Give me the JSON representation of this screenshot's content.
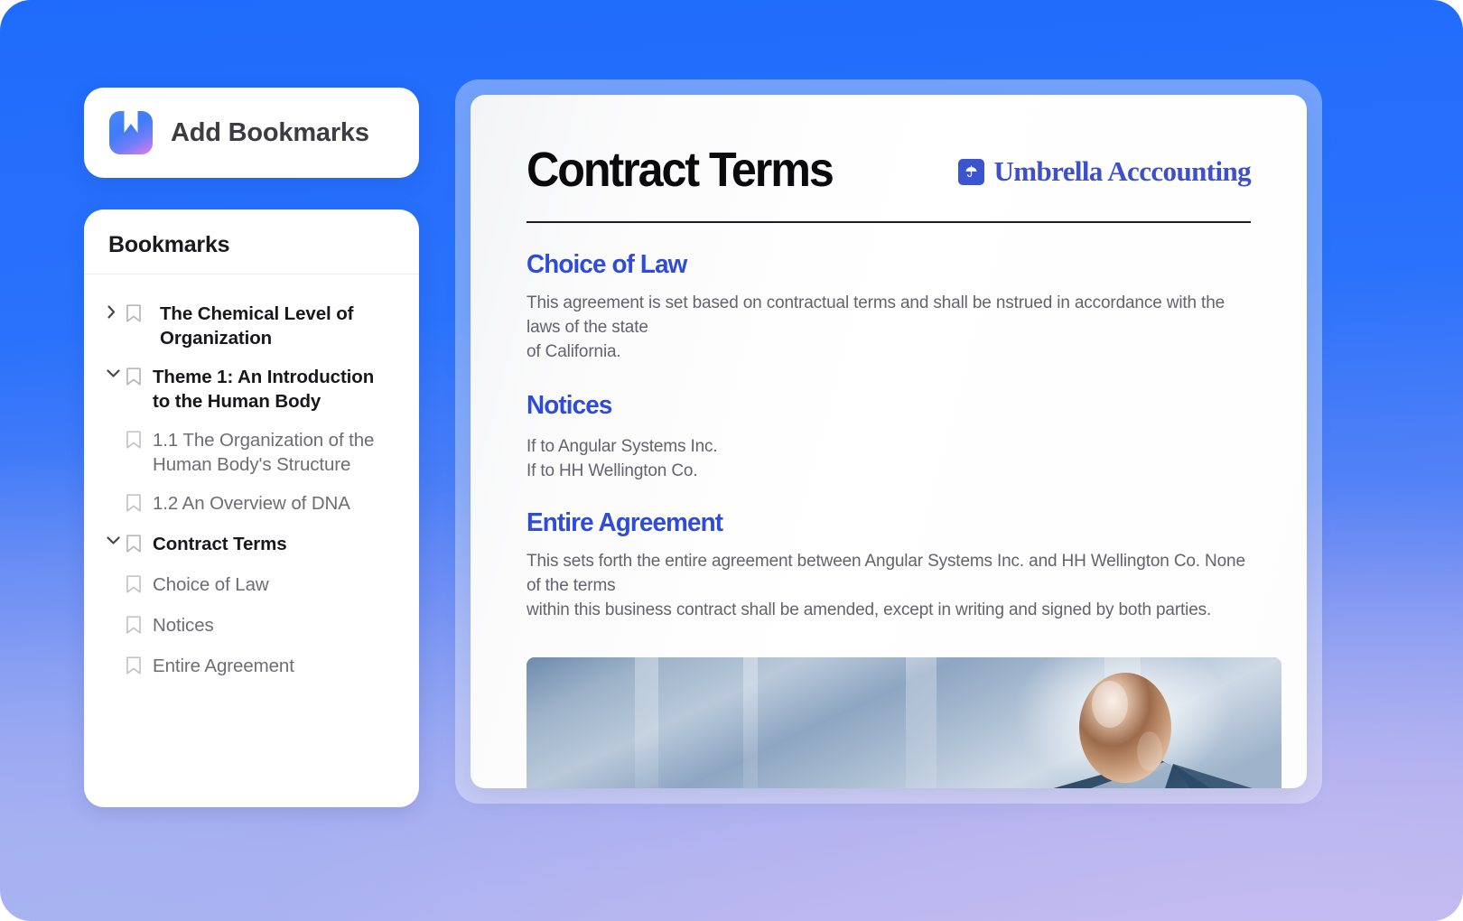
{
  "theme": {
    "bg_blue": "#1F6BFB",
    "bg_lavender": "#C0B8EF",
    "accent_heading": "#2F4BDB",
    "brand_blue": "#3D4FC9",
    "card_white": "#FFFFFF"
  },
  "sidebar": {
    "add_bookmarks": {
      "label": "Add Bookmarks",
      "icon": "bookmark-app-icon"
    },
    "panel_title": "Bookmarks",
    "items": [
      {
        "label": "The Chemical Level of Organization",
        "level": "top",
        "toggle": "chevron-right-icon",
        "expanded": false,
        "icon": "bookmark-ribbon-icon"
      },
      {
        "label": "Theme 1: An Introduction to the Human Body",
        "level": "top",
        "toggle": "chevron-down-icon",
        "expanded": true,
        "icon": "bookmark-ribbon-icon"
      },
      {
        "label": "1.1 The Organization of the Human Body's Structure",
        "level": "child",
        "toggle": "none",
        "icon": "bookmark-ribbon-icon"
      },
      {
        "label": "1.2 An Overview of DNA",
        "level": "child",
        "toggle": "none",
        "icon": "bookmark-ribbon-icon"
      },
      {
        "label": "Contract Terms",
        "level": "top",
        "toggle": "chevron-down-icon",
        "expanded": true,
        "icon": "bookmark-ribbon-icon"
      },
      {
        "label": "Choice of Law",
        "level": "child",
        "toggle": "none",
        "icon": "bookmark-ribbon-icon"
      },
      {
        "label": "Notices",
        "level": "child",
        "toggle": "none",
        "icon": "bookmark-ribbon-icon"
      },
      {
        "label": "Entire Agreement",
        "level": "child",
        "toggle": "none",
        "icon": "bookmark-ribbon-icon"
      }
    ]
  },
  "document": {
    "title": "Contract Terms",
    "brand": {
      "name": "Umbrella Acccounting",
      "icon": "umbrella-icon"
    },
    "sections": {
      "choice_of_law": {
        "heading": "Choice of Law",
        "line1": "This agreement is set based on contractual terms and shall be nstrued in accordance with the laws of the state",
        "line2": "of California."
      },
      "notices": {
        "heading": "Notices",
        "line1": "If to Angular Systems Inc.",
        "line2": "If to HH Wellington Co."
      },
      "entire_agreement": {
        "heading": "Entire Agreement",
        "line1": "This sets forth the entire agreement between Angular Systems Inc. and HH Wellington Co. None of the terms",
        "line2": "within this business contract shall be amended, except in writing and signed by both parties."
      }
    },
    "figure": {
      "name": "abstract-sphere-illustration",
      "description": "Abstract 3D render: bronze sphere above blue-grey angular planes"
    }
  }
}
